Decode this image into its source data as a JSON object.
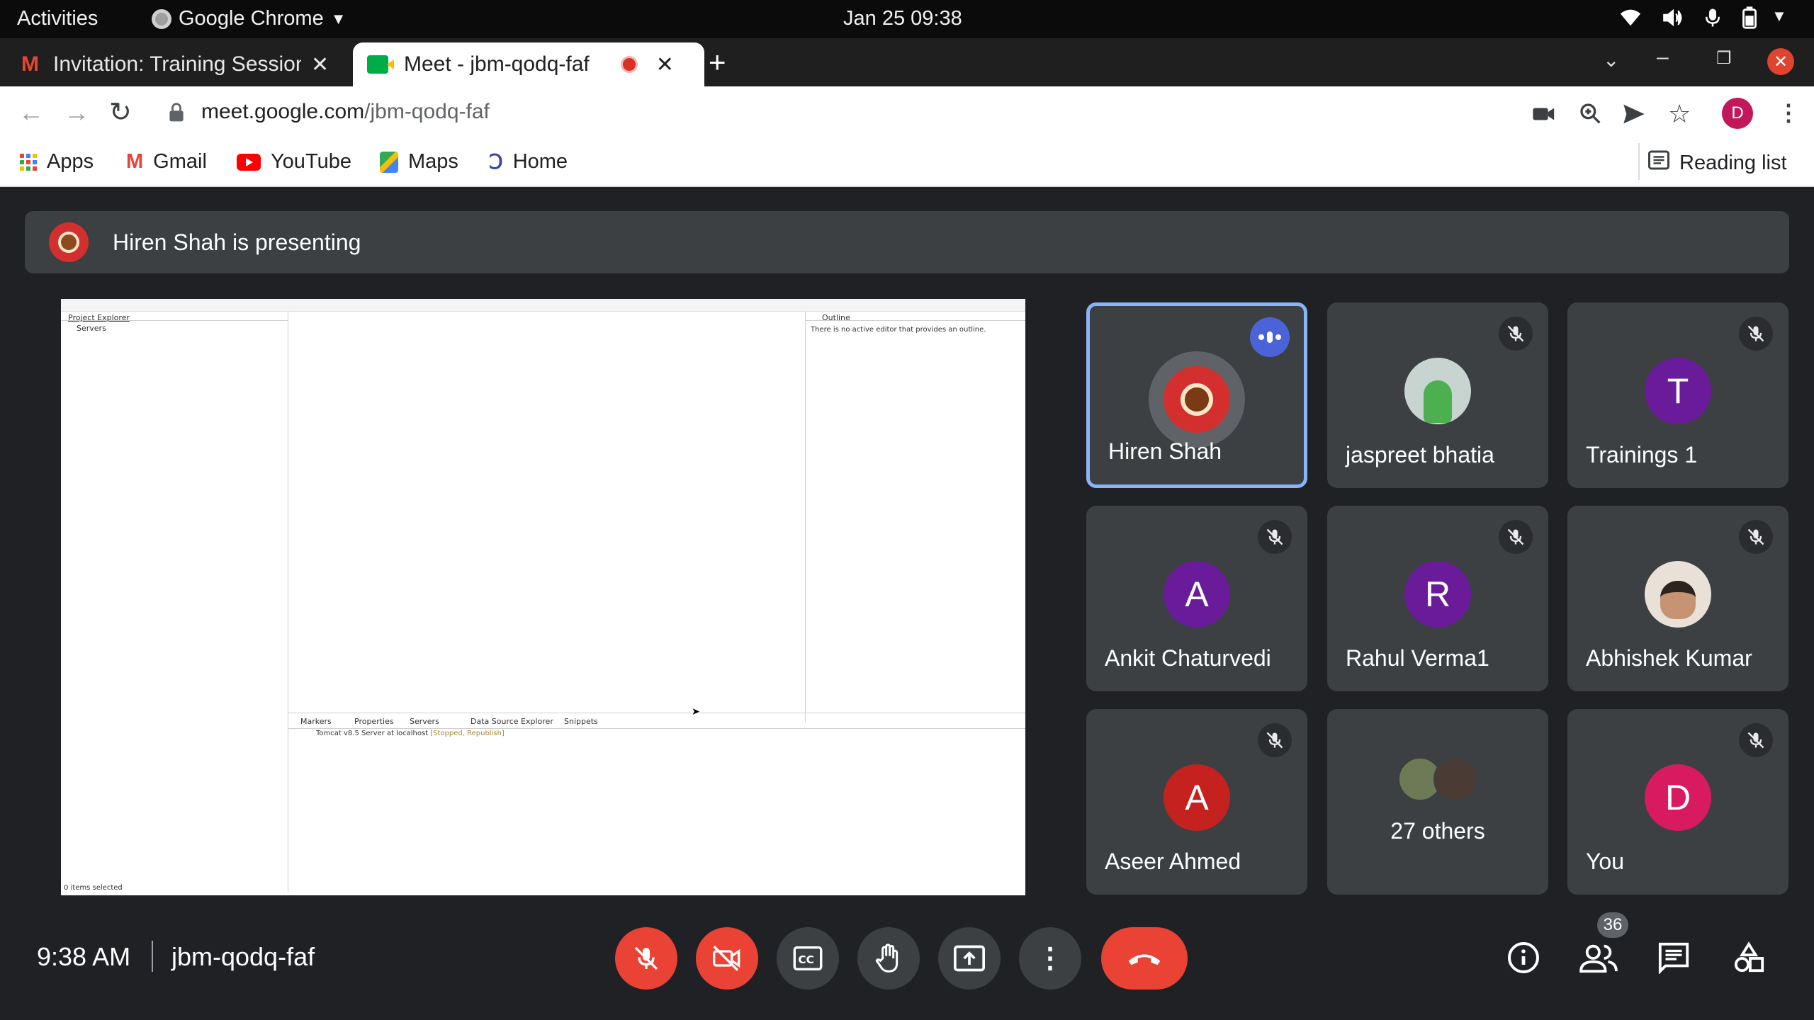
{
  "gnome": {
    "activities": "Activities",
    "app_name": "Google Chrome",
    "clock": "Jan 25  09:38"
  },
  "browser": {
    "tabs": [
      {
        "label": "Invitation: Training Session",
        "active": false
      },
      {
        "label": "Meet - jbm-qodq-faf",
        "active": true
      }
    ],
    "url_domain": "meet.google.com",
    "url_path": "/jbm-qodq-faf",
    "profile_initial": "D",
    "bookmarks": [
      "Apps",
      "Gmail",
      "YouTube",
      "Maps",
      "Home"
    ],
    "reading_list": "Reading list"
  },
  "meet": {
    "presenting_text": "Hiren Shah is presenting",
    "meeting_code": "jbm-qodq-faf",
    "time": "9:38 AM",
    "participant_count": "36",
    "colors": {
      "accent": "#8ab4f8",
      "end_call": "#ea4335",
      "tile_bg": "#3c4043"
    },
    "participants": [
      {
        "name": "Hiren Shah",
        "avatar": "photo",
        "speaking": true
      },
      {
        "name": "jaspreet bhatia",
        "avatar": "photo",
        "muted": true
      },
      {
        "name": "Trainings 1",
        "initial": "T",
        "color": "#6a1b9a",
        "muted": true
      },
      {
        "name": "Ankit Chaturvedi",
        "initial": "A",
        "color": "#6a1b9a",
        "muted": true
      },
      {
        "name": "Rahul Verma1",
        "initial": "R",
        "color": "#6a1b9a",
        "muted": true
      },
      {
        "name": "Abhishek Kumar",
        "avatar": "photo",
        "muted": true
      },
      {
        "name": "Aseer Ahmed",
        "initial": "A",
        "color": "#c5221f",
        "muted": true
      },
      {
        "name": "27 others",
        "avatar": "group"
      },
      {
        "name": "You",
        "initial": "D",
        "color": "#d81b60",
        "muted": true
      }
    ]
  },
  "shared_screen": {
    "project_explorer": "Project Explorer",
    "servers_node": "Servers",
    "outline_tab": "Outline",
    "outline_message": "There is no active editor that provides an outline.",
    "bottom_tabs": [
      "Markers",
      "Properties",
      "Servers",
      "Data Source Explorer",
      "Snippets"
    ],
    "server_entry": "Tomcat v8.5 Server at localhost",
    "server_status": "[Stopped, Republish]",
    "status_bar": "0 items selected"
  }
}
